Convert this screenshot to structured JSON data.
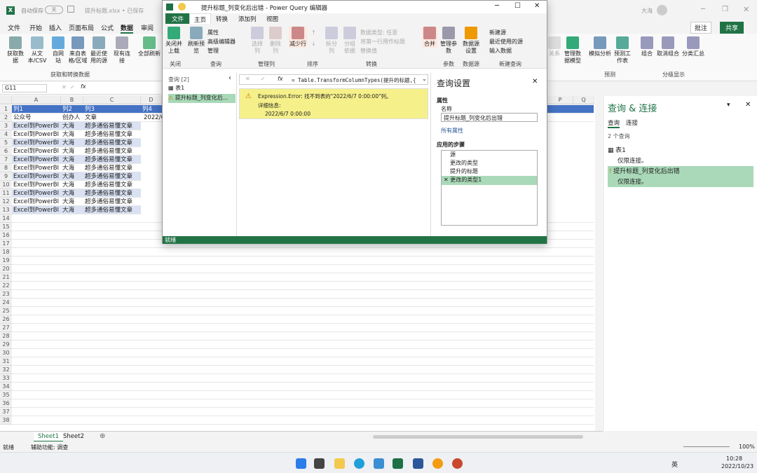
{
  "excel": {
    "autosave": "自动保存",
    "autosave_state": "关",
    "file_title": "提升标题.xlsx • 已保存",
    "user": "大海",
    "menu": [
      "文件",
      "开始",
      "插入",
      "页面布局",
      "公式",
      "数据",
      "审阅"
    ],
    "ribbon": {
      "get_data": "获取数据",
      "from_text": "从文本/CSV",
      "from_web": "自网站",
      "from_table": "来自表格/区域",
      "recent_sources": "最近使用的源",
      "existing": "现有连接",
      "refresh_all": "全部刷新",
      "group_get": "获取和转换数据",
      "relations": "关系",
      "manage_model": "管理数据模型",
      "what_if": "模拟分析",
      "forecast": "预测工作表",
      "group_forecast": "预测",
      "group": "组合",
      "ungroup": "取消组合",
      "subtotal": "分类汇总",
      "group_outline": "分级显示",
      "comment": "批注",
      "share": "共享"
    },
    "name_box": "G11",
    "columns": [
      "A",
      "B",
      "C",
      "D"
    ],
    "right_columns": [
      "P",
      "Q"
    ],
    "header_row": {
      "c1": "列1",
      "c2": "列2",
      "c3": "列3",
      "c4": "列4"
    },
    "row2": {
      "c1": "公众号",
      "c2": "创办人",
      "c3": "文章",
      "c4": "2022/6"
    },
    "data_row": {
      "c1": "Excel到PowerBI",
      "c2": "大海",
      "c3": "超多通俗易懂文章"
    },
    "sheets": [
      "Sheet1",
      "Sheet2"
    ],
    "status_ready": "就绪",
    "accessibility": "辅助功能: 调查",
    "zoom": "100%",
    "time": "10:28",
    "date": "2022/10/23",
    "ime": "英"
  },
  "queries_pane": {
    "title": "查询 & 连接",
    "tab_queries": "查询",
    "tab_connections": "连接",
    "count": "2 个查询",
    "items": [
      {
        "name": "表1",
        "sub": "仅限连接。"
      },
      {
        "name": "提升标题_列变化后出错",
        "sub": "仅限连接。"
      }
    ]
  },
  "pq": {
    "title": "提升标题_列变化后出错 - Power Query 编辑器",
    "tabs": [
      "文件",
      "主页",
      "转换",
      "添加列",
      "视图"
    ],
    "ribbon": {
      "close_load": "关闭并上载",
      "close": "关闭",
      "refresh": "刷新预览",
      "properties": "属性",
      "adv_editor": "高级编辑器",
      "manage": "管理",
      "query": "查询",
      "select_cols": "选择列",
      "remove_cols": "删除列",
      "manage_cols": "管理列",
      "reduce_rows": "减少行",
      "sort": "排序",
      "split": "拆分列",
      "group_by": "分组依据",
      "data_type": "数据类型: 任意",
      "first_row": "将第一行用作标题",
      "replace": "替换值",
      "transform": "转换",
      "combine": "合并",
      "manage_params": "管理参数",
      "params": "参数",
      "ds_settings": "数据源设置",
      "data_sources": "数据源",
      "new_source": "新建源",
      "recent_sources": "最近使用的源",
      "enter_data": "输入数据",
      "new_query": "新建查询"
    },
    "queries_header": "查询 [2]",
    "queries": [
      "表1",
      "提升标题_列变化后..."
    ],
    "formula": "= Table.TransformColumnTypes(提升的标题,{",
    "error_title": "Expression.Error: 找不到表的\"2022/6/7 0:00:00\"列。",
    "error_detail_label": "详细信息:",
    "error_detail": "2022/6/7 0:00:00",
    "settings_title": "查询设置",
    "props": "属性",
    "name_label": "名称",
    "name_value": "提升标题_列变化后出错",
    "all_props": "所有属性",
    "steps_title": "应用的步骤",
    "steps": [
      "源",
      "更改的类型",
      "提升的标题",
      "更改的类型1"
    ],
    "status": "就绪"
  },
  "colors": {
    "excel_green": "#217346",
    "header_blue": "#4472c4",
    "band": "#d9e1f2",
    "error_bg": "#f5f08a",
    "selected": "#a9d9b8"
  }
}
